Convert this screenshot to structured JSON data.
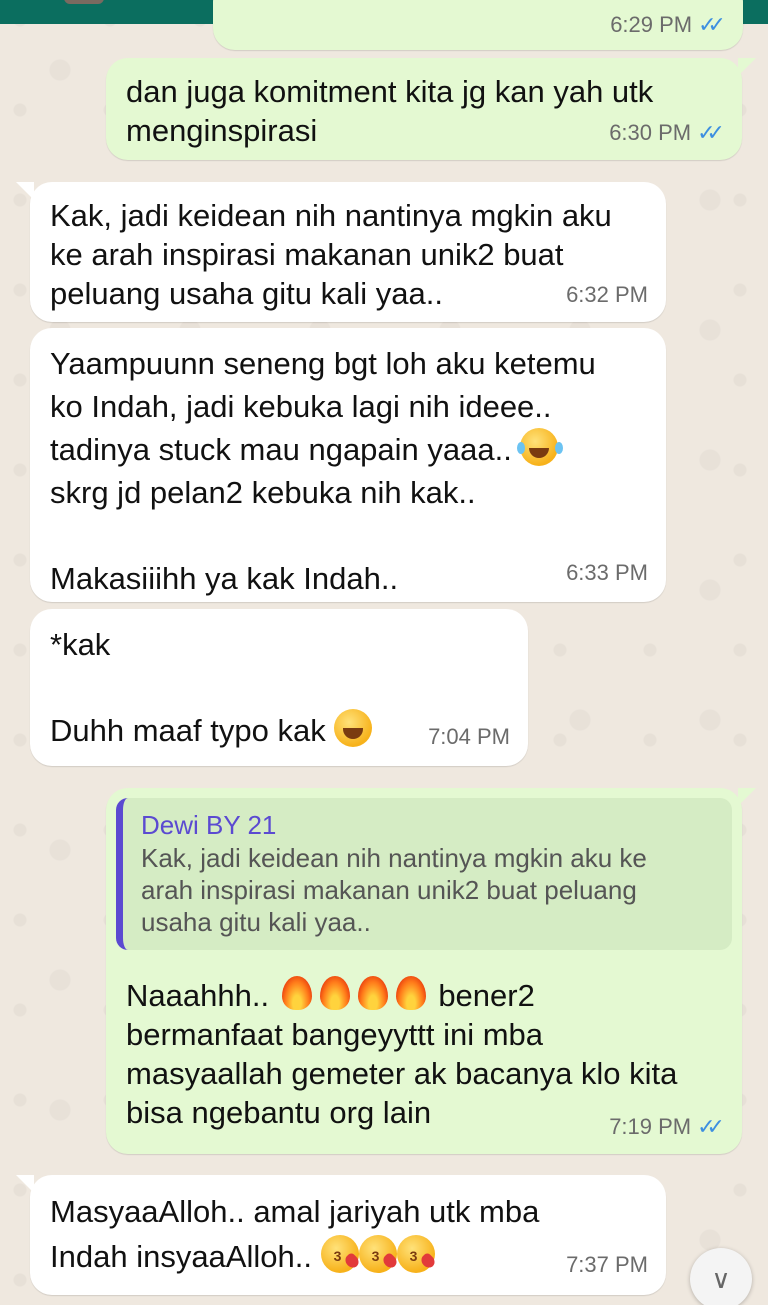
{
  "messages": [
    {
      "id": "m0",
      "direction": "out",
      "text": "",
      "time": "6:29 PM",
      "read": true
    },
    {
      "id": "m1",
      "direction": "out",
      "text": "dan juga komitment kita jg kan yah utk\nmenginspirasi",
      "time": "6:30 PM",
      "read": true
    },
    {
      "id": "m2",
      "direction": "in",
      "text": "Kak, jadi keidean nih nantinya mgkin aku\nke arah inspirasi makanan unik2 buat\npeluang usaha gitu kali yaa..",
      "time": "6:32 PM"
    },
    {
      "id": "m3",
      "direction": "in",
      "lines": [
        "Yaampuunn seneng bgt loh aku ketemu",
        "ko Indah, jadi kebuka lagi nih ideee..",
        "tadinya stuck mau ngapain yaaa..",
        "skrg jd pelan2 kebuka nih kak..",
        "",
        "Makasiiihh ya kak Indah.."
      ],
      "emoji": "face-with-tears-of-joy",
      "time": "6:33 PM"
    },
    {
      "id": "m4",
      "direction": "in",
      "lines": [
        "*kak",
        "",
        "Duhh maaf typo kak"
      ],
      "emoji": "grinning-squinting-face",
      "time": "7:04 PM"
    },
    {
      "id": "m5",
      "direction": "out",
      "quote": {
        "author": "Dewi BY 21",
        "text": "Kak, jadi keidean nih nantinya mgkin aku ke\narah inspirasi makanan unik2 buat peluang\nusaha gitu kali yaa.."
      },
      "lines": [
        "Naaahhh..",
        "bener2",
        "bermanfaat bangeyyttt ini mba",
        "masyaallah gemeter ak bacanya klo kita",
        "bisa ngebantu org lain"
      ],
      "emoji": "fire",
      "time": "7:19 PM",
      "read": true
    },
    {
      "id": "m6",
      "direction": "in",
      "lines": [
        "MasyaaAlloh.. amal jariyah utk mba",
        "Indah insyaaAlloh.."
      ],
      "emoji": "face-blowing-a-kiss",
      "time": "7:37 PM"
    }
  ],
  "icons": {
    "read_receipt": "double-check-icon",
    "scroll_down": "chevron-double-down-icon"
  },
  "colors": {
    "header": "#0b6e5f",
    "outgoing": "#e4f9d2",
    "incoming": "#ffffff",
    "ticks": "#3d8fe0",
    "quote_author": "#5b4ad1"
  }
}
